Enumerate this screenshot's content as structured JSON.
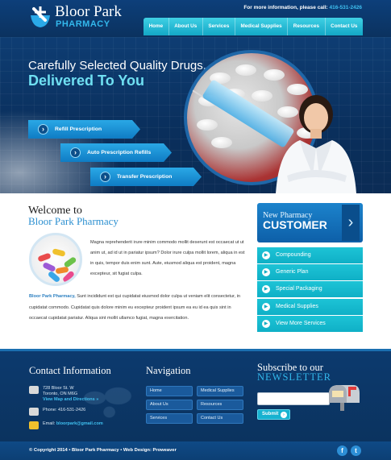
{
  "header": {
    "logo_name": "Bloor Park",
    "logo_sub": "PHARMACY",
    "info_text": "For more information, please call:",
    "info_phone": "416-531-2426",
    "nav": [
      "Home",
      "About Us",
      "Services",
      "Medical Supplies",
      "Resources",
      "Contact Us"
    ]
  },
  "hero": {
    "line1": "Carefully Selected Quality Drugs,",
    "line2": "Delivered To You",
    "buttons": [
      "Refill Prescription",
      "Auto Prescription Refills",
      "Transfer Prescription"
    ]
  },
  "welcome": {
    "title": "Welcome to",
    "name": "Bloor Park Pharmacy",
    "p1": "Magna reprehenderit irure minim commodo mollit deserunt est occaecat ut ut anim ut, ad id ut in pariatur ipsum? Dolor irure culpa mollit lorem, aliqua in est in quis, tempor duis enim sunt. Aute, eiusmod aliqua est proident, magna excepteur, sit fugiat culpa.",
    "p2_highlight": "Bloor Park Pharmacy,",
    "p2": " Sunt incididunt est qui cupidatat eiusmod dolor culpa ut veniam elit consectetur, in cupidatat commodo. Cupidatat quis dolore minim eu excepteur proident ipsum ea eu id ea quis sint in occaecat cupidatat pariatur. Aliqua sint mollit ullamco fugiat, magna exercitation."
  },
  "customer": {
    "small": "New Pharmacy",
    "big": "CUSTOMER"
  },
  "services": [
    "Compounding",
    "Generic Plan",
    "Special Packaging",
    "Medical Supplies",
    "View More Services"
  ],
  "footer": {
    "contact_title": "Contact Information",
    "address1": "728 Bloor St. W",
    "address2": "Toronto, ON M6G",
    "map_link": "View Map and Directions »",
    "phone": "Phone: 416-531-2426",
    "email_label": "Email:",
    "email": "bloorpark@gmail.com",
    "nav_title": "Navigation",
    "nav_items": [
      "Home",
      "Medical Supplies",
      "About Us",
      "Resources",
      "Services",
      "Contact Us"
    ],
    "subscribe_line1": "Subscribe to our",
    "subscribe_line2": "NEWSLETTER",
    "submit": "Submit"
  },
  "bottom": {
    "copyright": "© Copyright 2014  •  Bloor Park Pharmacy  •  Web Design: Proweaver",
    "facebook": "f",
    "twitter": "t"
  },
  "colors": {
    "navy": "#0b335f",
    "accent": "#33b8ec",
    "teal": "#1dc4d6",
    "link": "#2b7fc0"
  }
}
